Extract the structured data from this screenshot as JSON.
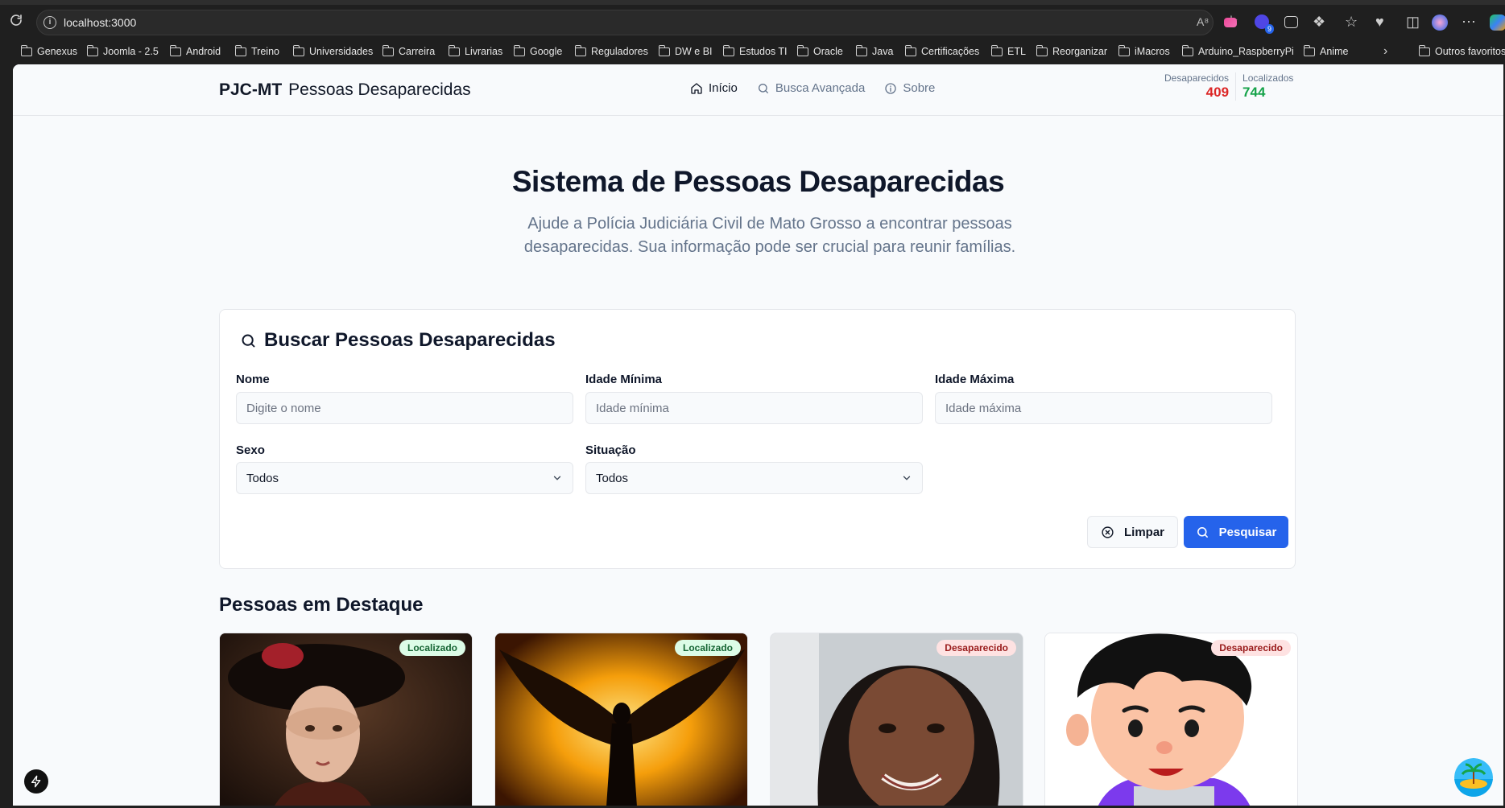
{
  "browser": {
    "url": "localhost:3000",
    "bookmarks": [
      "Genexus",
      "Joomla - 2.5",
      "Android",
      "Treino",
      "Universidades",
      "Carreira",
      "Livrarias",
      "Google",
      "Reguladores",
      "DW e BI",
      "Estudos TI",
      "Oracle",
      "Java",
      "Certificações",
      "ETL",
      "Reorganizar",
      "iMacros",
      "Arduino_RaspberryPi",
      "Anime"
    ],
    "bookmarks_more": "Outros favoritos",
    "extension_badge": "9"
  },
  "header": {
    "brand_short": "PJC-MT",
    "brand_long": "Pessoas Desaparecidas",
    "nav": [
      {
        "label": "Início",
        "icon": "home-icon"
      },
      {
        "label": "Busca Avançada",
        "icon": "search-icon"
      },
      {
        "label": "Sobre",
        "icon": "info-icon"
      }
    ],
    "stats": {
      "missing_label": "Desaparecidos",
      "missing_count": "409",
      "found_label": "Localizados",
      "found_count": "744"
    }
  },
  "hero": {
    "title": "Sistema de Pessoas Desaparecidas",
    "subtitle_line1": "Ajude a Polícia Judiciária Civil de Mato Grosso a encontrar pessoas",
    "subtitle_line2": "desaparecidas. Sua informação pode ser crucial para reunir famílias."
  },
  "search": {
    "title": "Buscar Pessoas Desaparecidas",
    "name_label": "Nome",
    "name_placeholder": "Digite o nome",
    "min_age_label": "Idade Mínima",
    "min_age_placeholder": "Idade mínima",
    "max_age_label": "Idade Máxima",
    "max_age_placeholder": "Idade máxima",
    "sex_label": "Sexo",
    "sex_value": "Todos",
    "status_label": "Situação",
    "status_value": "Todos",
    "clear_label": "Limpar",
    "search_label": "Pesquisar"
  },
  "featured": {
    "title": "Pessoas em Destaque",
    "cards": [
      {
        "status": "Localizado"
      },
      {
        "status": "Localizado"
      },
      {
        "status": "Desaparecido"
      },
      {
        "status": "Desaparecido"
      }
    ]
  },
  "colors": {
    "primary": "#2563eb",
    "missing": "#dc2626",
    "found": "#16a34a"
  }
}
